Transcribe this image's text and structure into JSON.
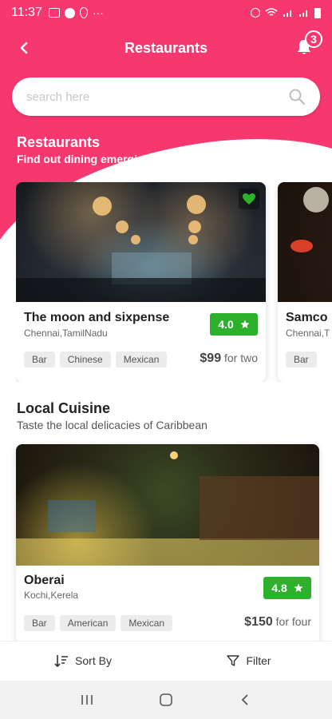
{
  "status": {
    "time": "11:37",
    "more": "···"
  },
  "header": {
    "title": "Restaurants",
    "notifications": "3"
  },
  "search": {
    "placeholder": "search here"
  },
  "restaurants_section": {
    "title": "Restaurants",
    "subtitle": "Find out dining emerging trends",
    "cards": [
      {
        "name": "The moon and sixpense",
        "location": "Chennai,TamilNadu",
        "rating": "4.0",
        "tags": [
          "Bar",
          "Chinese",
          "Mexican"
        ],
        "price": "$99",
        "price_suffix": "for two",
        "favorited": true
      },
      {
        "name": "Samco",
        "location": "Chennai,T",
        "tags": [
          "Bar"
        ]
      }
    ]
  },
  "local_section": {
    "title": "Local Cuisine",
    "subtitle": "Taste the local delicacies of Caribbean",
    "card": {
      "name": "Oberai",
      "location": "Kochi,Kerela",
      "rating": "4.8",
      "tags": [
        "Bar",
        "American",
        "Mexican"
      ],
      "price": "$150",
      "price_suffix": "for four"
    }
  },
  "actions": {
    "sort_label": "Sort By",
    "filter_label": "Filter"
  },
  "colors": {
    "brand": "#f7386f",
    "rating": "#2db12d",
    "heart": "#2db12d"
  }
}
